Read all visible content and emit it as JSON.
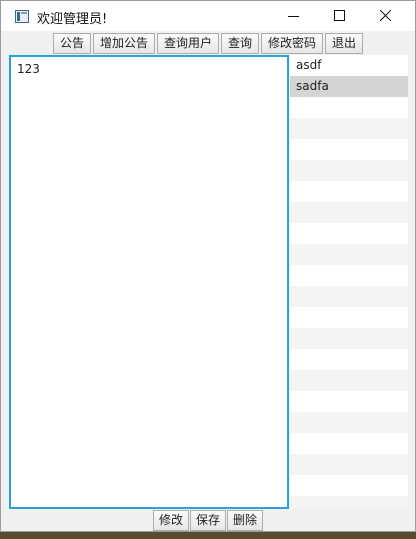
{
  "window": {
    "title": "欢迎管理员!"
  },
  "toolbar": {
    "buttons": [
      {
        "label": "公告"
      },
      {
        "label": "增加公告"
      },
      {
        "label": "查询用户"
      },
      {
        "label": "查询"
      },
      {
        "label": "修改密码"
      },
      {
        "label": "退出"
      }
    ]
  },
  "editor": {
    "content": "123"
  },
  "list": {
    "items": [
      {
        "label": "asdf"
      },
      {
        "label": "sadfa",
        "selected": true
      }
    ]
  },
  "bottom": {
    "buttons": [
      {
        "label": "修改"
      },
      {
        "label": "保存"
      },
      {
        "label": "删除"
      }
    ]
  }
}
